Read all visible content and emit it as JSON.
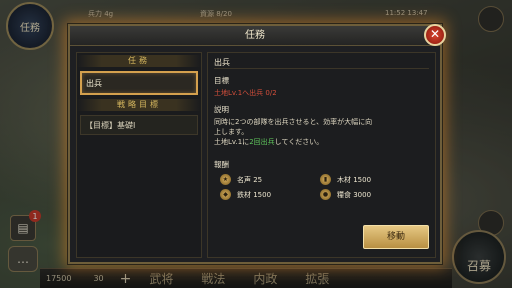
{
  "hud": {
    "emblem_label": "任務",
    "res1": "兵力 4g",
    "res2": "資源 8/20",
    "res3": "11:52 13:47",
    "badge_count": "1",
    "bottom_res1": "17500",
    "bottom_res2": "30",
    "bottom_plus": "+",
    "bottom_tabs": [
      "武将",
      "戦法",
      "内政",
      "拡張"
    ],
    "corner_label": "召募"
  },
  "dialog": {
    "title": "任務",
    "close_symbol": "✕",
    "left": {
      "section_missions": "任務",
      "missions": [
        "出兵"
      ],
      "section_strategy": "戦略目標",
      "strategy_items": [
        "【目標】基礎Ⅰ"
      ]
    },
    "right": {
      "header": "出兵",
      "goal_label": "目標",
      "goal_text": "土地Lv.1へ出兵 0/2",
      "desc_label": "説明",
      "desc_line1": "同時に2つの部隊を出兵させると、効率が大幅に向",
      "desc_line2": "上します。",
      "desc_line3_pre": "土地Lv.1に",
      "desc_line3_hl": "2回出兵",
      "desc_line3_post": "してください。",
      "reward_label": "報酬",
      "rewards": [
        {
          "icon": "fame-icon",
          "text": "名声 25"
        },
        {
          "icon": "wood-icon",
          "text": "木材 1500"
        },
        {
          "icon": "iron-icon",
          "text": "鉄材 1500"
        },
        {
          "icon": "food-icon",
          "text": "糧食 3000"
        }
      ],
      "move_button": "移動"
    }
  },
  "colors": {
    "accent_gold": "#d4a04e",
    "goal_red": "#d34e3b",
    "highlight_green": "#5fc65c",
    "close_red": "#c63a2a"
  }
}
